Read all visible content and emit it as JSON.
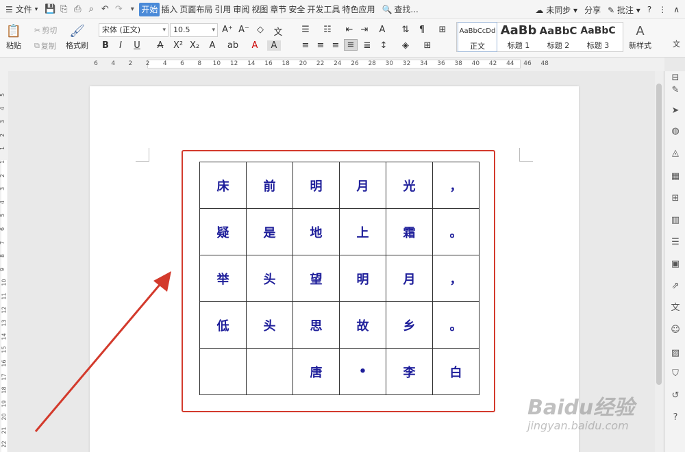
{
  "menubar": {
    "file_label": "文件",
    "tabs": [
      "开始",
      "插入",
      "页面布局",
      "引用",
      "审阅",
      "视图",
      "章节",
      "安全",
      "开发工具",
      "特色应用"
    ],
    "active_tab": "开始",
    "search_label": "查找...",
    "sync_label": "未同步",
    "share_label": "分享",
    "comment_label": "批注"
  },
  "ribbon": {
    "paste_label": "粘贴",
    "cut_label": "剪切",
    "copy_label": "复制",
    "format_painter_label": "格式刷",
    "font_name": "宋体 (正文)",
    "font_size": "10.5",
    "styles": [
      {
        "sample": "AaBbCcDd",
        "name": "正文"
      },
      {
        "sample": "AaBb",
        "name": "标题 1"
      },
      {
        "sample": "AaBbC",
        "name": "标题 2"
      },
      {
        "sample": "AaBbC",
        "name": "标题 3"
      }
    ],
    "new_style_label": "新样式",
    "more_label": "文"
  },
  "ruler": {
    "numbers": [
      "6",
      "4",
      "2",
      "2",
      "4",
      "6",
      "8",
      "10",
      "12",
      "14",
      "16",
      "18",
      "20",
      "22",
      "24",
      "26",
      "28",
      "30",
      "32",
      "34",
      "36",
      "38",
      "40",
      "42",
      "44",
      "46",
      "48"
    ]
  },
  "vruler": {
    "numbers": [
      "5",
      "4",
      "3",
      "2",
      "1",
      "1",
      "2",
      "3",
      "4",
      "5",
      "6",
      "7",
      "8",
      "9",
      "10",
      "11",
      "12",
      "13",
      "14",
      "15",
      "16",
      "17",
      "18",
      "19",
      "20",
      "21",
      "22"
    ]
  },
  "document": {
    "table": [
      [
        "床",
        "前",
        "明",
        "月",
        "光",
        "，"
      ],
      [
        "疑",
        "是",
        "地",
        "上",
        "霜",
        "。"
      ],
      [
        "举",
        "头",
        "望",
        "明",
        "月",
        "，"
      ],
      [
        "低",
        "头",
        "思",
        "故",
        "乡",
        "。"
      ],
      [
        "",
        "",
        "唐",
        "•",
        "李",
        "白"
      ]
    ]
  },
  "watermark": {
    "brand": "Baidu经验",
    "url": "jingyan.baidu.com"
  },
  "colors": {
    "accent": "#4a8ad8",
    "highlight_border": "#d33a2c",
    "poem_text": "#1e1e9a",
    "arrow": "#d33a2c"
  }
}
